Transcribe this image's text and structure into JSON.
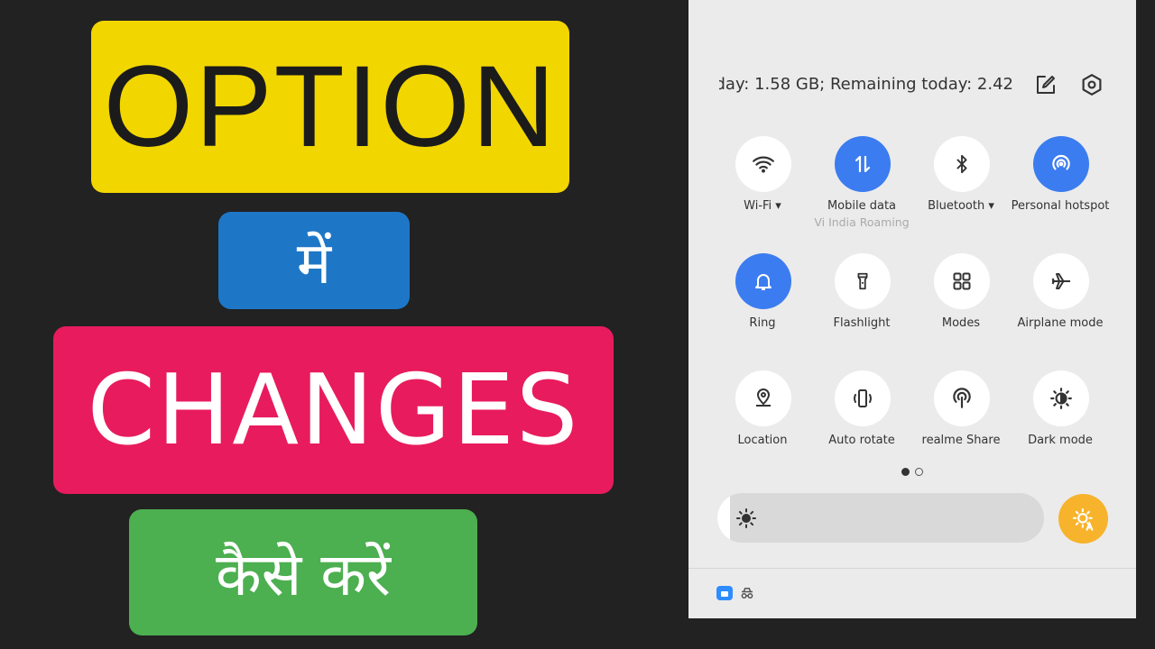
{
  "thumbnail": {
    "line1": "OPTION",
    "line2": "में",
    "line3": "CHANGES",
    "line4": "कैसे करें",
    "colors": {
      "yellow": "#f2d600",
      "blue": "#1e77c6",
      "pink": "#e81b5e",
      "green": "#4caf50"
    }
  },
  "quick_settings": {
    "data_usage_text": "day: 1.58 GB; Remaining today: 2.42",
    "header_icons": [
      "edit-icon",
      "settings-icon"
    ],
    "tiles": [
      {
        "label": "Wi-Fi ▾",
        "icon": "wifi-icon",
        "active": false
      },
      {
        "label": "Mobile data",
        "sub": "Vi India Roaming",
        "icon": "mobile-data-icon",
        "active": true
      },
      {
        "label": "Bluetooth ▾",
        "icon": "bluetooth-icon",
        "active": false
      },
      {
        "label": "Personal hotspot",
        "icon": "hotspot-icon",
        "active": true
      },
      {
        "label": "Ring",
        "icon": "bell-icon",
        "active": true
      },
      {
        "label": "Flashlight",
        "icon": "flashlight-icon",
        "active": false
      },
      {
        "label": "Modes",
        "icon": "modes-icon",
        "active": false
      },
      {
        "label": "Airplane mode",
        "icon": "airplane-icon",
        "active": false
      },
      {
        "label": "Location",
        "icon": "location-icon",
        "active": false
      },
      {
        "label": "Auto rotate",
        "icon": "auto-rotate-icon",
        "active": false
      },
      {
        "label": "realme Share",
        "icon": "realme-share-icon",
        "active": false
      },
      {
        "label": "Dark mode",
        "icon": "dark-mode-icon",
        "active": false
      }
    ],
    "page_indicator": {
      "pages": 2,
      "current": 1
    },
    "brightness_level": 0.04,
    "accent_color": "#3b7cf0",
    "auto_brightness_color": "#f7b32b"
  }
}
